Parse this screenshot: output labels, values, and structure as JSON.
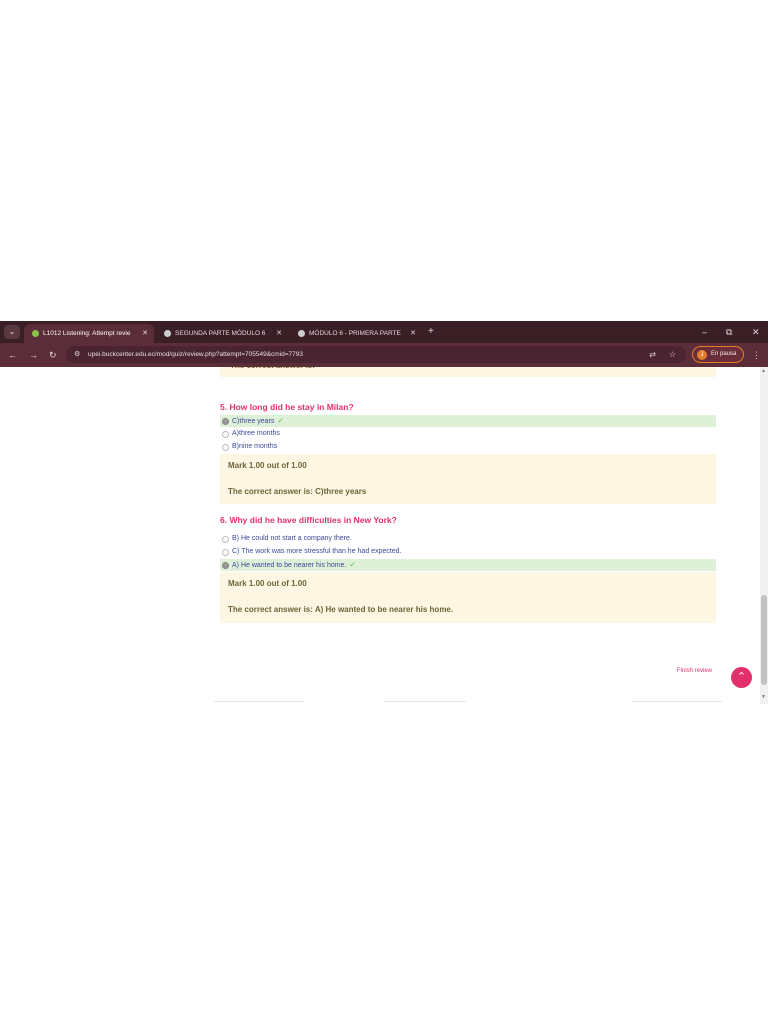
{
  "browser": {
    "tabs": [
      {
        "label": "L1012 Listening: Attempt revie",
        "active": true,
        "icon_color": "#8bc34a"
      },
      {
        "label": "SEGUNDA PARTE MÓDULO 6 (",
        "active": false,
        "icon_color": "#cfcfcf"
      },
      {
        "label": "MÓDULO 6 - PRIMERA PARTE",
        "active": false,
        "icon_color": "#cfcfcf"
      }
    ],
    "new_tab": "+",
    "url": "upei.buckcenter.edu.ec/mod/quiz/review.php?attempt=705549&cmid=7793",
    "profile_label": "En pausa",
    "profile_initial": "J",
    "window_min": "–",
    "window_max": "⧉",
    "window_close": "✕"
  },
  "questions": [
    {
      "title": "5. How long did he stay in Milan?",
      "options": [
        {
          "text": "C)three years",
          "selected": true,
          "correct": true
        },
        {
          "text": "A)three months",
          "selected": false,
          "correct": false
        },
        {
          "text": "B)nine months",
          "selected": false,
          "correct": false
        }
      ],
      "mark": "Mark 1.00 out of 1.00",
      "correct_answer": "The correct answer is: C)three years"
    },
    {
      "title": "6. Why did he have difficulties in New York?",
      "options": [
        {
          "text": "B) He could not start a company there.",
          "selected": false,
          "correct": false
        },
        {
          "text": "C) The work was more stressful than he had expected.",
          "selected": false,
          "correct": false
        },
        {
          "text": "A) He wanted to be nearer his home.",
          "selected": true,
          "correct": true
        }
      ],
      "mark": "Mark 1.00 out of 1.00",
      "correct_answer": "The correct answer is: A) He wanted to be nearer his home."
    }
  ],
  "finish_review": "Finish review",
  "colors": {
    "accent": "#e2306c",
    "correct_bg": "#dff0d8",
    "feedback_bg": "#fcf6e3",
    "browser_dark": "#3b1f27"
  }
}
